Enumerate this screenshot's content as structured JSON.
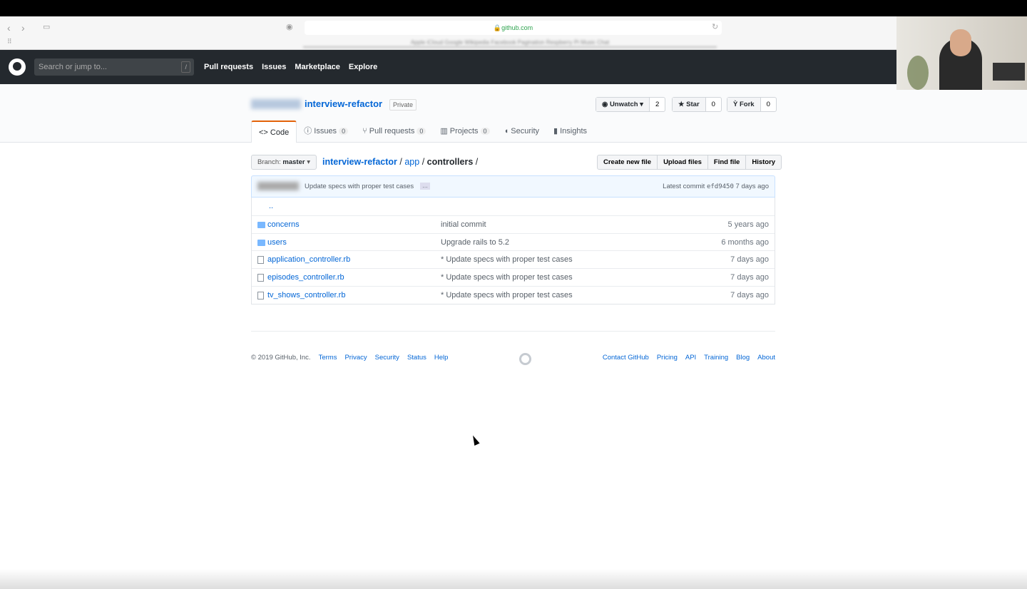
{
  "browser": {
    "url": "github.com",
    "bookmarks": "Apple iCloud Google Wikipedia Facebook Pagination Respberry Pi Music Chat"
  },
  "header": {
    "search_placeholder": "Search or jump to...",
    "search_shortcut": "/",
    "nav": [
      "Pull requests",
      "Issues",
      "Marketplace",
      "Explore"
    ]
  },
  "repo": {
    "name": "interview-refactor",
    "visibility": "Private",
    "watch": {
      "label": "Unwatch",
      "count": "2"
    },
    "star": {
      "label": "Star",
      "count": "0"
    },
    "fork": {
      "label": "Fork",
      "count": "0"
    }
  },
  "tabs": [
    {
      "label": "Code"
    },
    {
      "label": "Issues",
      "count": "0"
    },
    {
      "label": "Pull requests",
      "count": "0"
    },
    {
      "label": "Projects",
      "count": "0"
    },
    {
      "label": "Security"
    },
    {
      "label": "Insights"
    }
  ],
  "branch": {
    "prefix": "Branch:",
    "name": "master"
  },
  "breadcrumb": {
    "root": "interview-refactor",
    "sep": "/",
    "app": "app",
    "current": "controllers"
  },
  "file_buttons": [
    "Create new file",
    "Upload files",
    "Find file",
    "History"
  ],
  "commit": {
    "message": "Update specs with proper test cases",
    "ellipsis": "…",
    "latest_label": "Latest commit",
    "sha": "efd9450",
    "age": "7 days ago"
  },
  "updir": "..",
  "files": [
    {
      "type": "dir",
      "name": "concerns",
      "message": "initial commit",
      "age": "5 years ago"
    },
    {
      "type": "dir",
      "name": "users",
      "message": "Upgrade rails to 5.2",
      "age": "6 months ago"
    },
    {
      "type": "file",
      "name": "application_controller.rb",
      "message": "* Update specs with proper test cases",
      "age": "7 days ago"
    },
    {
      "type": "file",
      "name": "episodes_controller.rb",
      "message": "* Update specs with proper test cases",
      "age": "7 days ago"
    },
    {
      "type": "file",
      "name": "tv_shows_controller.rb",
      "message": "* Update specs with proper test cases",
      "age": "7 days ago"
    }
  ],
  "footer": {
    "copyright": "© 2019 GitHub, Inc.",
    "left_links": [
      "Terms",
      "Privacy",
      "Security",
      "Status",
      "Help"
    ],
    "right_links": [
      "Contact GitHub",
      "Pricing",
      "API",
      "Training",
      "Blog",
      "About"
    ]
  }
}
